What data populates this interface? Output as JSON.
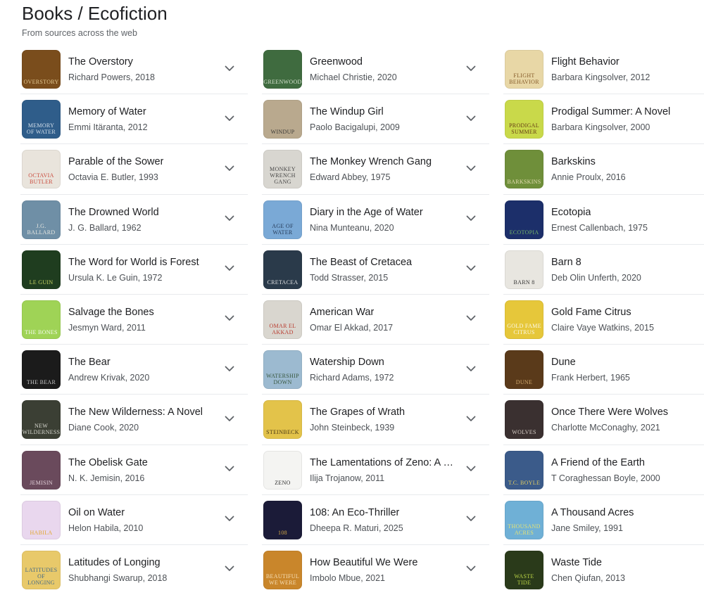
{
  "header": {
    "title": "Books / Ecofiction",
    "subtitle": "From sources across the web"
  },
  "icons": {
    "expand": "chevron-down-icon"
  },
  "columns": [
    {
      "items": [
        {
          "title": "The Overstory",
          "meta": "Richard Powers, 2018",
          "cover_bg": "#7a4d1c",
          "cover_fg": "#f0d8a0",
          "cover_text": "Overstory"
        },
        {
          "title": "Memory of Water",
          "meta": "Emmi Itäranta, 2012",
          "cover_bg": "#2f5d8a",
          "cover_fg": "#e6eef6",
          "cover_text": "memory of water"
        },
        {
          "title": "Parable of the Sower",
          "meta": "Octavia E. Butler, 1993",
          "cover_bg": "#e9e4dc",
          "cover_fg": "#c63a2c",
          "cover_text": "Octavia Butler"
        },
        {
          "title": "The Drowned World",
          "meta": "J. G. Ballard, 1962",
          "cover_bg": "#6f8fa6",
          "cover_fg": "#f4f1e8",
          "cover_text": "J.G. Ballard"
        },
        {
          "title": "The Word for World is Forest",
          "meta": "Ursula K. Le Guin, 1972",
          "cover_bg": "#1f3d1f",
          "cover_fg": "#d7e36b",
          "cover_text": "Le Guin"
        },
        {
          "title": "Salvage the Bones",
          "meta": "Jesmyn Ward, 2011",
          "cover_bg": "#9fd356",
          "cover_fg": "#ffffff",
          "cover_text": "the Bones"
        },
        {
          "title": "The Bear",
          "meta": "Andrew Krivak, 2020",
          "cover_bg": "#1b1b1b",
          "cover_fg": "#d9d9d9",
          "cover_text": "The Bear"
        },
        {
          "title": "The New Wilderness: A Novel",
          "meta": "Diane Cook, 2020",
          "cover_bg": "#3b3f34",
          "cover_fg": "#e8e8e0",
          "cover_text": "New Wilderness"
        },
        {
          "title": "The Obelisk Gate",
          "meta": "N. K. Jemisin, 2016",
          "cover_bg": "#6a4a5c",
          "cover_fg": "#f0e0e8",
          "cover_text": "Jemisin"
        },
        {
          "title": "Oil on Water",
          "meta": "Helon Habila, 2010",
          "cover_bg": "#e9d7ee",
          "cover_fg": "#e0a21c",
          "cover_text": "Habila"
        },
        {
          "title": "Latitudes of Longing",
          "meta": "Shubhangi Swarup, 2018",
          "cover_bg": "#e8c96a",
          "cover_fg": "#2f5d8a",
          "cover_text": "Latitudes of Longing"
        }
      ]
    },
    {
      "items": [
        {
          "title": "Greenwood",
          "meta": "Michael Christie, 2020",
          "cover_bg": "#3f6b3f",
          "cover_fg": "#e8f0e0",
          "cover_text": "Greenwood"
        },
        {
          "title": "The Windup Girl",
          "meta": "Paolo Bacigalupi, 2009",
          "cover_bg": "#b9a98e",
          "cover_fg": "#2b2b2b",
          "cover_text": "Windup"
        },
        {
          "title": "The Monkey Wrench Gang",
          "meta": "Edward Abbey, 1975",
          "cover_bg": "#d8d6d0",
          "cover_fg": "#333333",
          "cover_text": "Monkey Wrench Gang"
        },
        {
          "title": "Diary in the Age of Water",
          "meta": "Nina Munteanu, 2020",
          "cover_bg": "#7aa9d6",
          "cover_fg": "#1c2e4a",
          "cover_text": "Age of Water"
        },
        {
          "title": "The Beast of Cretacea",
          "meta": "Todd Strasser, 2015",
          "cover_bg": "#2a3a4a",
          "cover_fg": "#f2f2f2",
          "cover_text": "Cretacea"
        },
        {
          "title": "American War",
          "meta": "Omar El Akkad, 2017",
          "cover_bg": "#d9d6cf",
          "cover_fg": "#b52b1e",
          "cover_text": "Omar El Akkad"
        },
        {
          "title": "Watership Down",
          "meta": "Richard Adams, 1972",
          "cover_bg": "#9cbad0",
          "cover_fg": "#2c4b2c",
          "cover_text": "Watership Down"
        },
        {
          "title": "The Grapes of Wrath",
          "meta": "John Steinbeck, 1939",
          "cover_bg": "#e3c34a",
          "cover_fg": "#3a2a10",
          "cover_text": "Steinbeck"
        },
        {
          "title": "The Lamentations of Zeno: A Novel",
          "meta": "Ilija Trojanow, 2011",
          "cover_bg": "#f4f4f2",
          "cover_fg": "#111111",
          "cover_text": "Zeno"
        },
        {
          "title": "108: An Eco-Thriller",
          "meta": "Dheepa R. Maturi, 2025",
          "cover_bg": "#1b1b38",
          "cover_fg": "#e8b84a",
          "cover_text": "108"
        },
        {
          "title": "How Beautiful We Were",
          "meta": "Imbolo Mbue, 2021",
          "cover_bg": "#c9862b",
          "cover_fg": "#fbe9c6",
          "cover_text": "Beautiful We Were"
        }
      ]
    },
    {
      "items": [
        {
          "title": "Flight Behavior",
          "meta": "Barbara Kingsolver, 2012",
          "cover_bg": "#e8d7a6",
          "cover_fg": "#7a4d1c",
          "cover_text": "Flight Behavior"
        },
        {
          "title": "Prodigal Summer: A Novel",
          "meta": "Barbara Kingsolver, 2000",
          "cover_bg": "#c9d94a",
          "cover_fg": "#5a2a10",
          "cover_text": "Prodigal Summer"
        },
        {
          "title": "Barkskins",
          "meta": "Annie Proulx, 2016",
          "cover_bg": "#6f8f3a",
          "cover_fg": "#f2e6c0",
          "cover_text": "Barkskins"
        },
        {
          "title": "Ecotopia",
          "meta": "Ernest Callenbach, 1975",
          "cover_bg": "#1c2f6a",
          "cover_fg": "#7fc36a",
          "cover_text": "Ecotopia"
        },
        {
          "title": "Barn 8",
          "meta": "Deb Olin Unferth, 2020",
          "cover_bg": "#e8e6e0",
          "cover_fg": "#1b1b1b",
          "cover_text": "Barn 8"
        },
        {
          "title": "Gold Fame Citrus",
          "meta": "Claire Vaye Watkins, 2015",
          "cover_bg": "#e6c73a",
          "cover_fg": "#ffffff",
          "cover_text": "Gold Fame Citrus"
        },
        {
          "title": "Dune",
          "meta": "Frank Herbert, 1965",
          "cover_bg": "#5a3a1a",
          "cover_fg": "#e0b878",
          "cover_text": "Dune"
        },
        {
          "title": "Once There Were Wolves",
          "meta": "Charlotte McConaghy, 2021",
          "cover_bg": "#3a3030",
          "cover_fg": "#e8e0d8",
          "cover_text": "Wolves"
        },
        {
          "title": "A Friend of the Earth",
          "meta": "T Coraghessan Boyle, 2000",
          "cover_bg": "#3b5b8a",
          "cover_fg": "#f0d860",
          "cover_text": "T.C. Boyle"
        },
        {
          "title": "A Thousand Acres",
          "meta": "Jane Smiley, 1991",
          "cover_bg": "#6fb0d6",
          "cover_fg": "#f2e86a",
          "cover_text": "Thousand Acres"
        },
        {
          "title": "Waste Tide",
          "meta": "Chen Qiufan, 2013",
          "cover_bg": "#2a3a1a",
          "cover_fg": "#c8e34a",
          "cover_text": "Waste Tide"
        }
      ]
    }
  ]
}
